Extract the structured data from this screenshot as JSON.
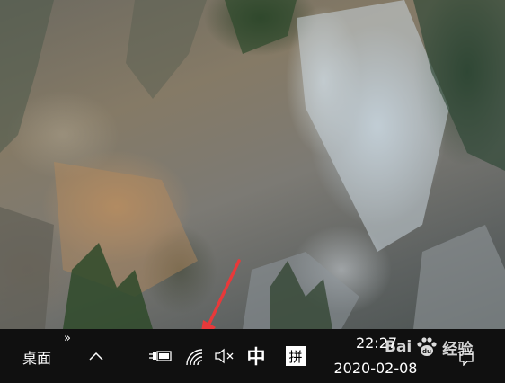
{
  "wallpaper": {
    "description_icon": "mountain-cliff-wallpaper"
  },
  "taskbar": {
    "desktop_label": "桌面",
    "overflow_icon": "double-chevron-right-icon",
    "show_hidden_icon": "chevron-up-icon",
    "system_tray": {
      "power_icon": "power-plug-battery-icon",
      "network_icon": "wifi-icon",
      "volume_icon": "volume-muted-icon",
      "ime_language": "中",
      "ime_mode": "拼"
    },
    "clock": {
      "time": "22:27",
      "date": "2020-02-08"
    },
    "notification_icon": "notification-center-icon"
  },
  "watermark": {
    "brand_left": "Bai",
    "brand_right": "经验",
    "brand_mid": "du"
  },
  "annotation": {
    "arrow_color": "#e8393a"
  }
}
